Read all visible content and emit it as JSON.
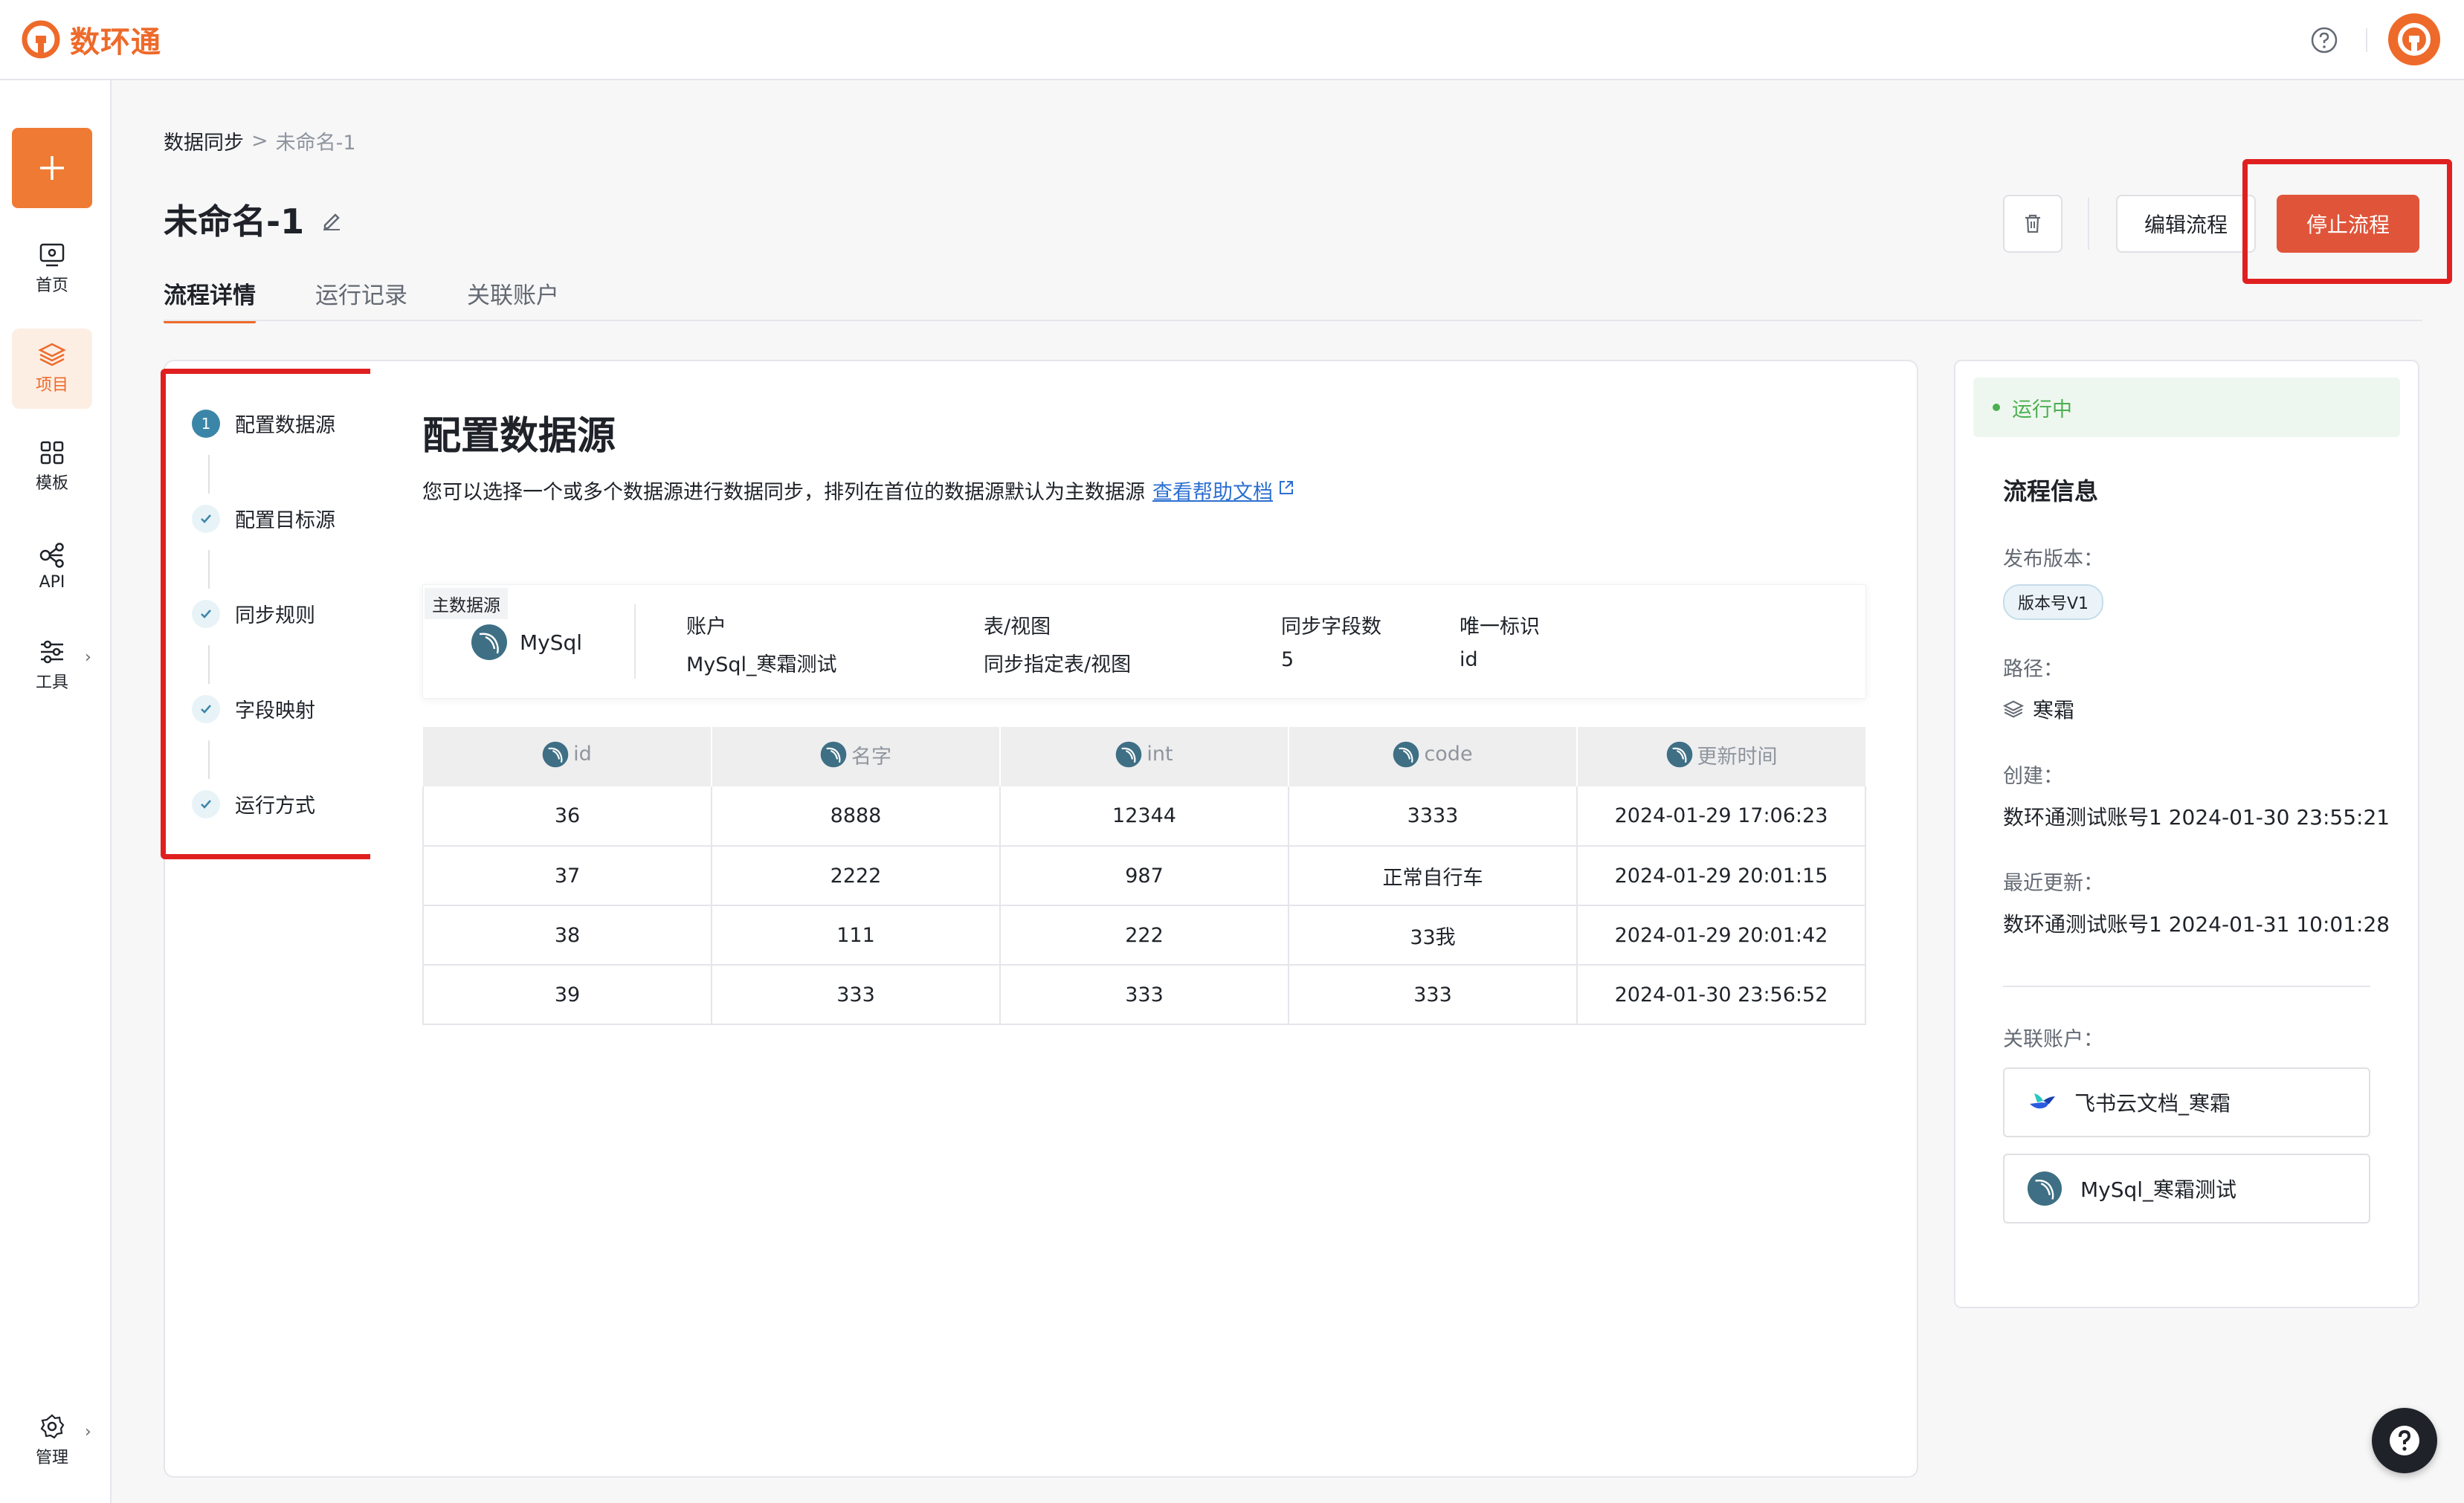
{
  "app": {
    "logo_text": "数环通",
    "brand_color": "#ee6a2a",
    "highlight_color": "#e02020"
  },
  "rail": {
    "items": [
      {
        "label": "首页",
        "icon": "monitor-icon"
      },
      {
        "label": "项目",
        "icon": "layers-icon",
        "active": true
      },
      {
        "label": "模板",
        "icon": "grid-icon"
      },
      {
        "label": "API",
        "icon": "api-icon"
      },
      {
        "label": "工具",
        "icon": "sliders-icon"
      },
      {
        "label": "管理",
        "icon": "gear-icon"
      }
    ]
  },
  "breadcrumb": {
    "parent": "数据同步",
    "sep": ">",
    "current": "未命名-1"
  },
  "page": {
    "title": "未命名-1"
  },
  "tabs": [
    {
      "label": "流程详情",
      "active": true
    },
    {
      "label": "运行记录"
    },
    {
      "label": "关联账户"
    }
  ],
  "actions": {
    "edit_label": "编辑流程",
    "stop_label": "停止流程"
  },
  "steps": [
    {
      "label": "配置数据源",
      "index": "1",
      "state": "active"
    },
    {
      "label": "配置目标源",
      "state": "done"
    },
    {
      "label": "同步规则",
      "state": "done"
    },
    {
      "label": "字段映射",
      "state": "done"
    },
    {
      "label": "运行方式",
      "state": "done"
    }
  ],
  "section": {
    "title": "配置数据源",
    "desc": "您可以选择一个或多个数据源进行数据同步，排列在首位的数据源默认为主数据源",
    "help_link": "查看帮助文档"
  },
  "source": {
    "tag": "主数据源",
    "name": "MySql",
    "account_label": "账户",
    "account_value": "MySql_寒霜测试",
    "table_label": "表/视图",
    "table_value": "同步指定表/视图",
    "fields_label": "同步字段数",
    "fields_value": "5",
    "key_label": "唯一标识",
    "key_value": "id"
  },
  "table": {
    "columns": [
      "id",
      "名字",
      "int",
      "code",
      "更新时间"
    ],
    "rows": [
      [
        "36",
        "8888",
        "12344",
        "3333",
        "2024-01-29 17:06:23"
      ],
      [
        "37",
        "2222",
        "987",
        "正常自行车",
        "2024-01-29 20:01:15"
      ],
      [
        "38",
        "111",
        "222",
        "33我",
        "2024-01-29 20:01:42"
      ],
      [
        "39",
        "333",
        "333",
        "333",
        "2024-01-30 23:56:52"
      ]
    ]
  },
  "info": {
    "status": "运行中",
    "status_color": "#4caf50",
    "heading": "流程信息",
    "version_label": "发布版本：",
    "version_value": "版本号V1",
    "path_label": "路径：",
    "path_value": "寒霜",
    "created_label": "创建：",
    "created_value": "数环通测试账号1 2024-01-30 23:55:21",
    "updated_label": "最近更新：",
    "updated_value": "数环通测试账号1 2024-01-31 10:01:28",
    "accounts_label": "关联账户：",
    "accounts": [
      {
        "name": "飞书云文档_寒霜",
        "icon": "feishu-icon"
      },
      {
        "name": "MySql_寒霜测试",
        "icon": "mysql-icon"
      }
    ]
  }
}
